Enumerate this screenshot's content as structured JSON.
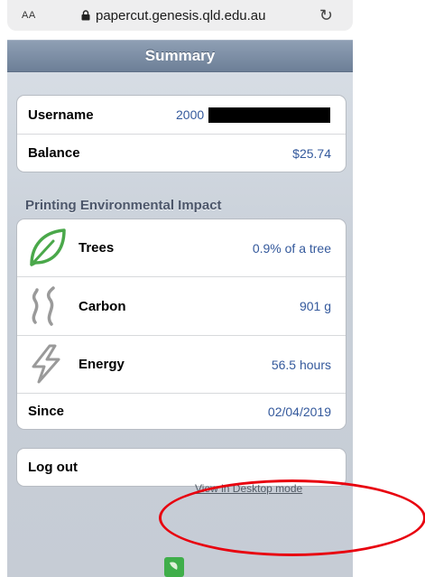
{
  "browser": {
    "text_size_label": "AA",
    "url": "papercut.genesis.qld.edu.au",
    "reload_icon": "reload-icon",
    "lock_icon": "lock-icon"
  },
  "header": {
    "title": "Summary"
  },
  "account": {
    "username_label": "Username",
    "username_value": "2000",
    "balance_label": "Balance",
    "balance_value": "$25.74"
  },
  "impact": {
    "section_title": "Printing Environmental Impact",
    "trees_label": "Trees",
    "trees_value": "0.9% of a tree",
    "carbon_label": "Carbon",
    "carbon_value": "901 g",
    "energy_label": "Energy",
    "energy_value": "56.5 hours",
    "since_label": "Since",
    "since_value": "02/04/2019"
  },
  "actions": {
    "logout_label": "Log out"
  },
  "footer": {
    "desktop_mode_label": "View in Desktop mode"
  },
  "colors": {
    "link": "#34599c",
    "annotation": "#e8000e",
    "header": "#7a8ba2"
  }
}
